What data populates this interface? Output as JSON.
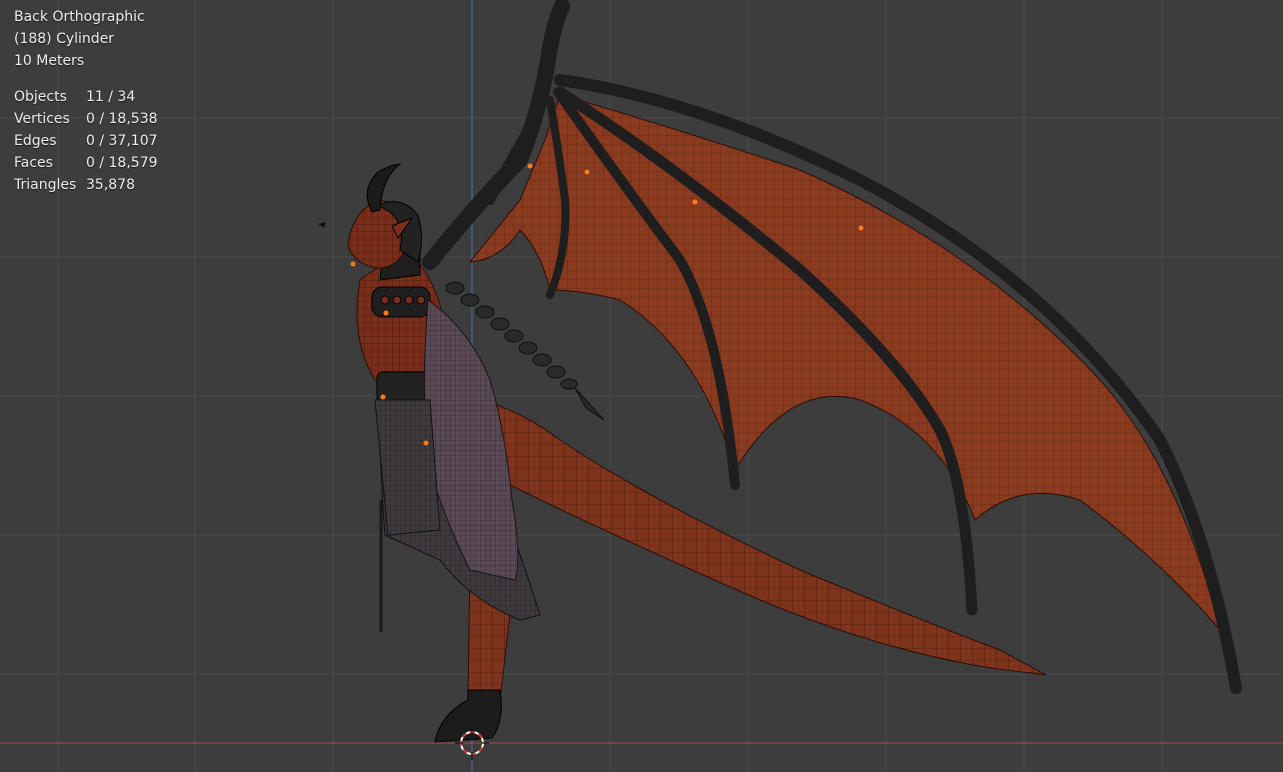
{
  "viewport": {
    "view_name": "Back Orthographic",
    "active_object": "(188) Cylinder",
    "grid_scale": "10 Meters",
    "colors": {
      "background": "#3d3d3d",
      "grid": "#4a4a4a",
      "axis_x": "#b8454a",
      "axis_z": "#4f6fa8",
      "membrane": "#8a3a1f",
      "bone": "#1f1f1f",
      "wire": "#1a0c08",
      "cloth": "#5c4b57"
    }
  },
  "stats": [
    {
      "label": "Objects",
      "value": "11 / 34"
    },
    {
      "label": "Vertices",
      "value": "0 / 18,538"
    },
    {
      "label": "Edges",
      "value": "0 / 37,107"
    },
    {
      "label": "Faces",
      "value": "0 / 18,579"
    },
    {
      "label": "Triangles",
      "value": "35,878"
    }
  ]
}
